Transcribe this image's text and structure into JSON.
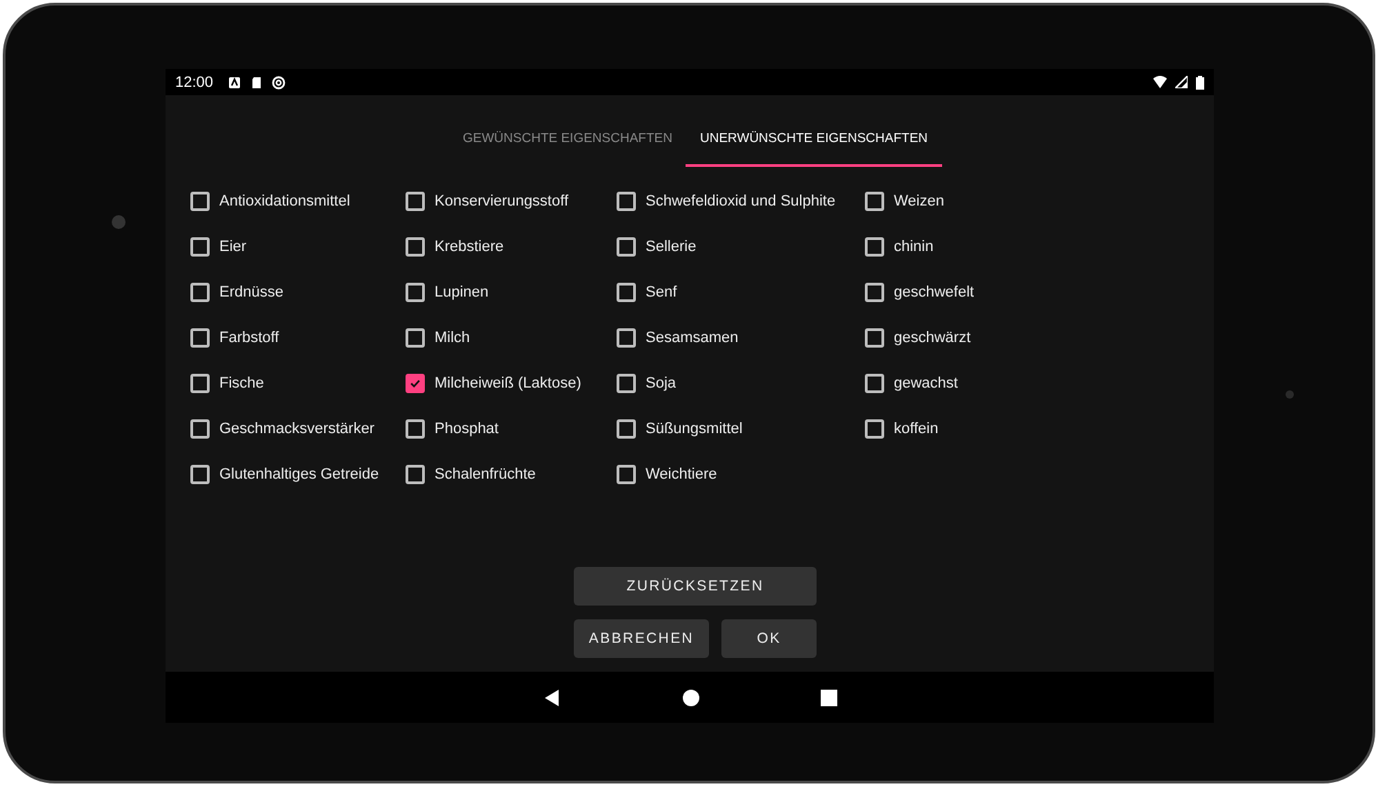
{
  "status_bar": {
    "time": "12:00"
  },
  "tabs": [
    {
      "label": "GEWÜNSCHTE EIGENSCHAFTEN",
      "selected": false
    },
    {
      "label": "UNERWÜNSCHTE EIGENSCHAFTEN",
      "selected": true
    }
  ],
  "columns": [
    {
      "items": [
        {
          "label": "Antioxidationsmittel",
          "checked": false
        },
        {
          "label": "Eier",
          "checked": false
        },
        {
          "label": "Erdnüsse",
          "checked": false
        },
        {
          "label": "Farbstoff",
          "checked": false
        },
        {
          "label": "Fische",
          "checked": false
        },
        {
          "label": "Geschmacksverstärker",
          "checked": false
        },
        {
          "label": "Glutenhaltiges Getreide",
          "checked": false
        }
      ]
    },
    {
      "items": [
        {
          "label": "Konservierungsstoff",
          "checked": false
        },
        {
          "label": "Krebstiere",
          "checked": false
        },
        {
          "label": "Lupinen",
          "checked": false
        },
        {
          "label": "Milch",
          "checked": false
        },
        {
          "label": "Milcheiweiß (Laktose)",
          "checked": true
        },
        {
          "label": "Phosphat",
          "checked": false
        },
        {
          "label": "Schalenfrüchte",
          "checked": false
        }
      ]
    },
    {
      "items": [
        {
          "label": "Schwefeldioxid und Sulphite",
          "checked": false
        },
        {
          "label": "Sellerie",
          "checked": false
        },
        {
          "label": "Senf",
          "checked": false
        },
        {
          "label": "Sesamsamen",
          "checked": false
        },
        {
          "label": "Soja",
          "checked": false
        },
        {
          "label": "Süßungsmittel",
          "checked": false
        },
        {
          "label": "Weichtiere",
          "checked": false
        }
      ]
    },
    {
      "items": [
        {
          "label": "Weizen",
          "checked": false
        },
        {
          "label": "chinin",
          "checked": false
        },
        {
          "label": "geschwefelt",
          "checked": false
        },
        {
          "label": "geschwärzt",
          "checked": false
        },
        {
          "label": "gewachst",
          "checked": false
        },
        {
          "label": "koffein",
          "checked": false
        }
      ]
    }
  ],
  "buttons": {
    "reset": "ZURÜCKSETZEN",
    "cancel": "ABBRECHEN",
    "ok": "OK"
  }
}
